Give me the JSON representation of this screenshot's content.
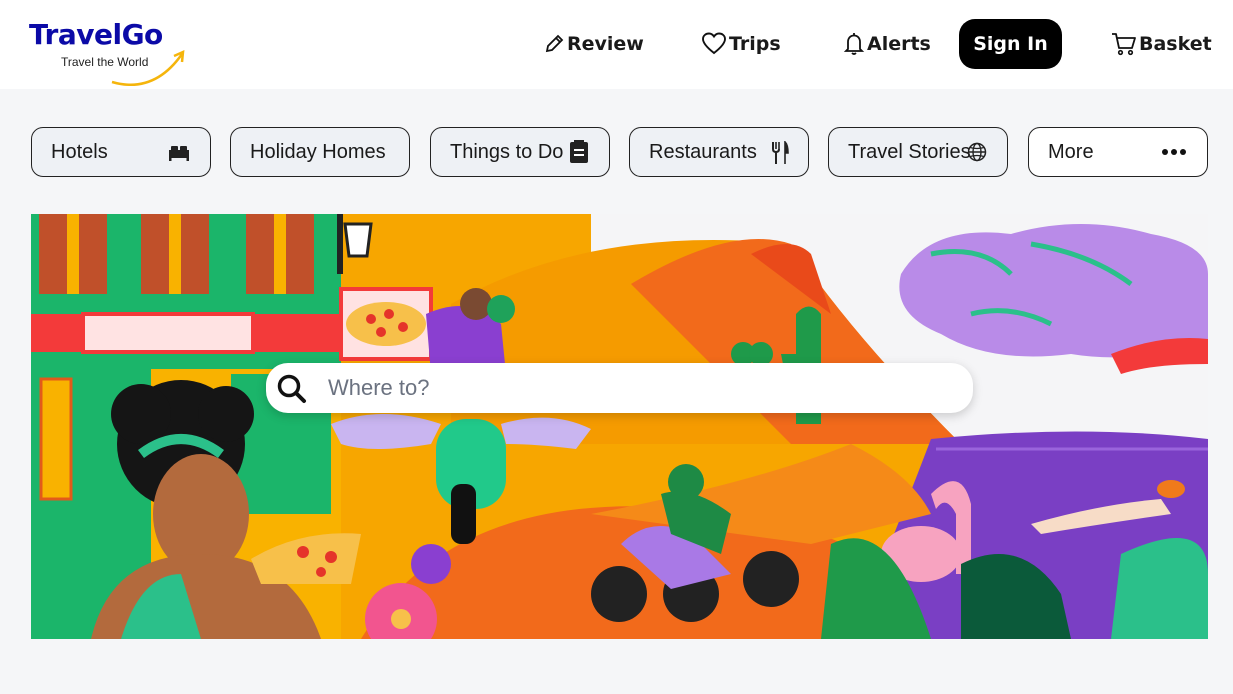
{
  "brand": {
    "name": "TravelGo",
    "tagline": "Travel the World",
    "primary_color": "#0b0aa7",
    "accent_color": "#f5b50c"
  },
  "nav": {
    "review": {
      "label": "Review",
      "icon": "pencil-icon"
    },
    "trips": {
      "label": "Trips",
      "icon": "heart-icon"
    },
    "alerts": {
      "label": "Alerts",
      "icon": "bell-icon"
    },
    "sign_in": {
      "label": "Sign In"
    },
    "basket": {
      "label": "Basket",
      "icon": "cart-icon"
    }
  },
  "categories": [
    {
      "label": "Hotels",
      "icon": "bed-icon"
    },
    {
      "label": "Holiday Homes",
      "icon": ""
    },
    {
      "label": "Things to Do",
      "icon": "ticket-icon"
    },
    {
      "label": "Restaurants",
      "icon": "fork-knife-icon"
    },
    {
      "label": "Travel Stories",
      "icon": "globe-icon"
    },
    {
      "label": "More",
      "icon": "ellipsis-icon"
    }
  ],
  "search": {
    "placeholder": "Where to?",
    "value": ""
  }
}
